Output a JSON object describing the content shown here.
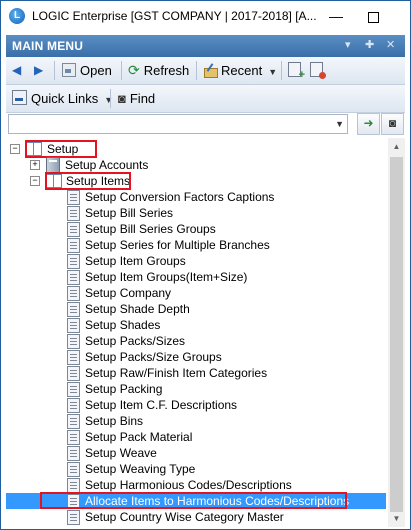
{
  "window": {
    "title": "LOGIC Enterprise [GST COMPANY  | 2017-2018] [A...",
    "logo_letter": "L",
    "minimize_glyph": "—"
  },
  "panel": {
    "title": "MAIN MENU",
    "controls": [
      "▾",
      "✚",
      "✕"
    ]
  },
  "toolbar": {
    "back_arrow": "◀",
    "forward_arrow": "▶",
    "open_label": "Open",
    "refresh_label": "Refresh",
    "refresh_glyph": "⟳",
    "recent_label": "Recent",
    "dropdown_glyph": "▼"
  },
  "toolbar2": {
    "quick_links_label": "Quick Links",
    "find_label": "Find",
    "find_glyph": "◙"
  },
  "search": {
    "value": "",
    "placeholder": "",
    "go_glyph": "➜",
    "find_glyph": "◙"
  },
  "tree": {
    "root": "Setup",
    "accounts": "Setup Accounts",
    "items_group": "Setup Items",
    "items": [
      "Setup Conversion Factors Captions",
      "Setup Bill Series",
      "Setup Bill Series Groups",
      "Setup Series for Multiple Branches",
      "Setup Item Groups",
      "Setup Item Groups(Item+Size)",
      "Setup Company",
      "Setup Shade Depth",
      "Setup Shades",
      "Setup Packs/Sizes",
      "Setup Packs/Size Groups",
      "Setup Raw/Finish Item Categories",
      "Setup Packing",
      "Setup Item C.F. Descriptions",
      "Setup Bins",
      "Setup Pack Material",
      "Setup Weave",
      "Setup Weaving Type",
      "Setup Harmonious Codes/Descriptions",
      "Allocate Items to Harmonious Codes/Descriptions",
      "Setup Country Wise Category Master"
    ],
    "selected_index": 19,
    "collapse_glyph": "−",
    "expand_glyph": "+"
  },
  "colors": {
    "selection": "#3399ff",
    "highlight_box": "#e3141f",
    "panel_header": "#3a6ea8"
  }
}
